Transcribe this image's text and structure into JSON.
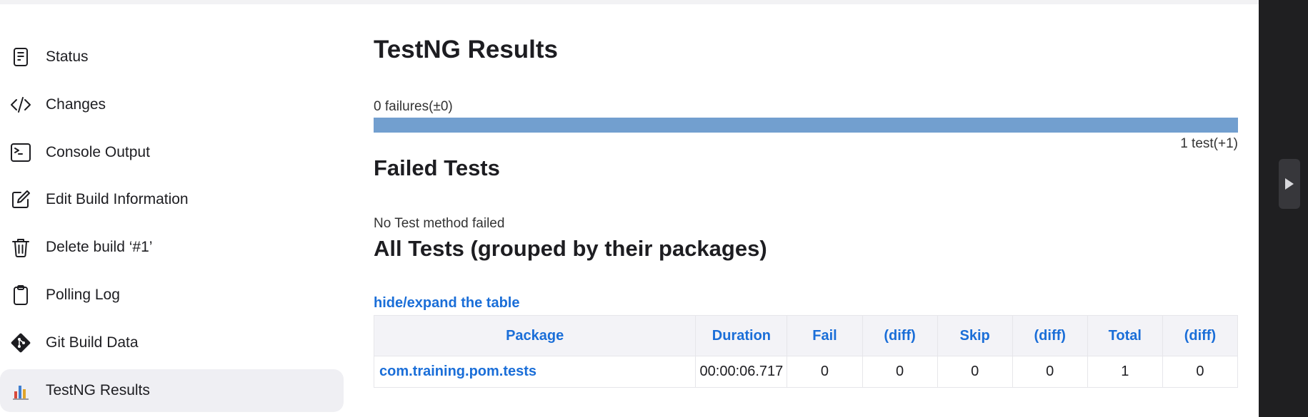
{
  "sidebar": {
    "items": [
      {
        "label": "Status",
        "icon": "document-icon"
      },
      {
        "label": "Changes",
        "icon": "code-icon"
      },
      {
        "label": "Console Output",
        "icon": "terminal-icon"
      },
      {
        "label": "Edit Build Information",
        "icon": "edit-icon"
      },
      {
        "label": "Delete build ‘#1’",
        "icon": "trash-icon"
      },
      {
        "label": "Polling Log",
        "icon": "clipboard-icon"
      },
      {
        "label": "Git Build Data",
        "icon": "git-icon"
      },
      {
        "label": "TestNG Results",
        "icon": "chart-icon",
        "active": true
      }
    ]
  },
  "main": {
    "title": "TestNG Results",
    "failures_caption": "0 failures(±0)",
    "progress_pass_fraction": 1.0,
    "progress_color": "#729fcf",
    "tests_caption": "1 test(+1)",
    "failed_heading": "Failed Tests",
    "no_failed_text": "No Test method failed",
    "all_heading": "All Tests (grouped by their packages)",
    "toggle_link": "hide/expand the table",
    "table": {
      "headers": [
        "Package",
        "Duration",
        "Fail",
        "(diff)",
        "Skip",
        "(diff)",
        "Total",
        "(diff)"
      ],
      "rows": [
        [
          "com.training.pom.tests",
          "00:00:06.717",
          "0",
          "0",
          "0",
          "0",
          "1",
          "0"
        ]
      ]
    }
  },
  "colors": {
    "accent": "#1a6ed8",
    "active_bg": "#efeff3",
    "right_panel": "#1f1f21"
  }
}
